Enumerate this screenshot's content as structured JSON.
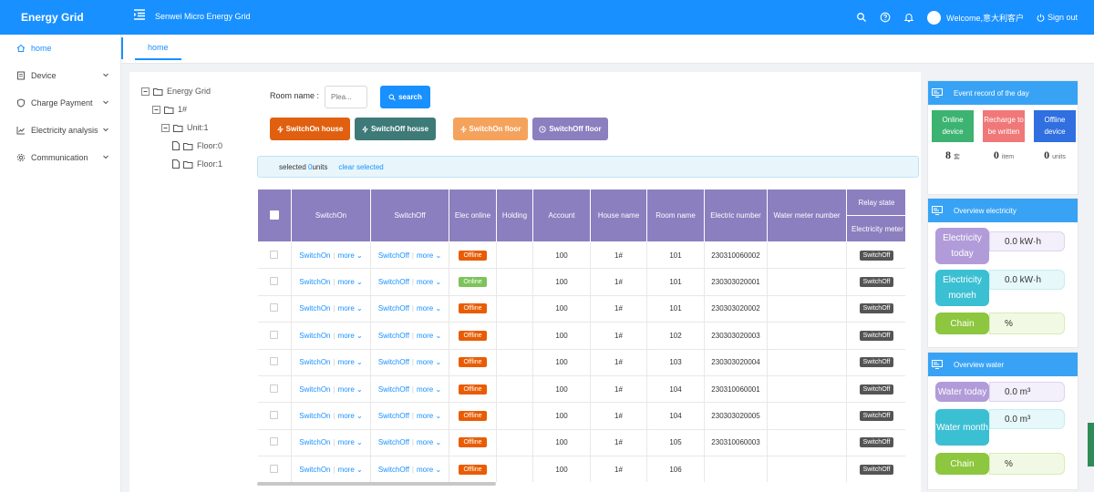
{
  "header": {
    "brand": "Energy Grid",
    "app_title": "Senwei Micro Energy Grid",
    "welcome": "Welcome,意大利客户",
    "sign_out": "Sign out"
  },
  "sidebar": {
    "items": [
      {
        "label": "home",
        "icon": "home-icon"
      },
      {
        "label": "Device",
        "icon": "device-icon"
      },
      {
        "label": "Charge Payment",
        "icon": "payment-icon"
      },
      {
        "label": "Electricity analysis",
        "icon": "chart-icon"
      },
      {
        "label": "Communication",
        "icon": "settings-icon"
      }
    ]
  },
  "tabs": {
    "home": "home"
  },
  "tree": {
    "root": "Energy Grid",
    "building": "1#",
    "unit": "Unit:1",
    "floors": [
      "Floor:0",
      "Floor:1"
    ]
  },
  "filter": {
    "room_label": "Room name :",
    "room_placeholder": "Plea...",
    "search": "search",
    "switch_on_house": "SwitchOn house",
    "switch_off_house": "SwitchOff house",
    "switch_on_floor": "SwitchOn floor",
    "switch_off_floor": "SwitchOff floor"
  },
  "selection": {
    "prefix": "selected ",
    "count": "0",
    "suffix": "units",
    "clear": "clear selected"
  },
  "table": {
    "headers": {
      "switch_on": "SwitchOn",
      "switch_off": "SwitchOff",
      "elec_online": "Elec online",
      "holding": "Holding",
      "account": "Account",
      "house_name": "House name",
      "room_name": "Room name",
      "electric_number": "Electric number",
      "water_meter_number": "Water meter number",
      "relay_state": "Relay state",
      "electricity_meter": "Electricity meter"
    },
    "link_switch_on": "SwitchOn",
    "link_switch_off": "SwitchOff",
    "link_more": "more",
    "rows": [
      {
        "elec": "Offline",
        "account": "100",
        "house": "1#",
        "room": "101",
        "electric": "230310060002",
        "relay": "SwitchOff"
      },
      {
        "elec": "Online",
        "account": "100",
        "house": "1#",
        "room": "101",
        "electric": "230303020001",
        "relay": "SwitchOff"
      },
      {
        "elec": "Offline",
        "account": "100",
        "house": "1#",
        "room": "101",
        "electric": "230303020002",
        "relay": "SwitchOff"
      },
      {
        "elec": "Offline",
        "account": "100",
        "house": "1#",
        "room": "102",
        "electric": "230303020003",
        "relay": "SwitchOff"
      },
      {
        "elec": "Offline",
        "account": "100",
        "house": "1#",
        "room": "103",
        "electric": "230303020004",
        "relay": "SwitchOff"
      },
      {
        "elec": "Offline",
        "account": "100",
        "house": "1#",
        "room": "104",
        "electric": "230310060001",
        "relay": "SwitchOff"
      },
      {
        "elec": "Offline",
        "account": "100",
        "house": "1#",
        "room": "104",
        "electric": "230303020005",
        "relay": "SwitchOff"
      },
      {
        "elec": "Offline",
        "account": "100",
        "house": "1#",
        "room": "105",
        "electric": "230310060003",
        "relay": "SwitchOff"
      },
      {
        "elec": "Offline",
        "account": "100",
        "house": "1#",
        "room": "106",
        "electric": "",
        "relay": "SwitchOff"
      }
    ]
  },
  "event_panel": {
    "title": "Event record of the day",
    "online_device": "Online device",
    "recharge": "Recharge to be written",
    "offline_device": "Offline device",
    "online_value": "8",
    "online_unit": "套",
    "recharge_value": "0",
    "recharge_unit": "item",
    "offline_value": "0",
    "offline_unit": "units",
    "colors": {
      "online": "#3cb371",
      "recharge": "#f07878",
      "offline": "#2f6fe0"
    }
  },
  "electricity_panel": {
    "title": "Overview electricity",
    "today_label": "Electricity today",
    "today_value": "0.0 kW·h",
    "month_label": "Electricity moneh",
    "month_value": "0.0 kW·h",
    "chain_label": "Chain",
    "chain_value": "%"
  },
  "water_panel": {
    "title": "Overview water",
    "today_label": "Water today",
    "today_value": "0.0 m³",
    "month_label": "Water month",
    "month_value": "0.0 m³",
    "chain_label": "Chain",
    "chain_value": "%"
  }
}
